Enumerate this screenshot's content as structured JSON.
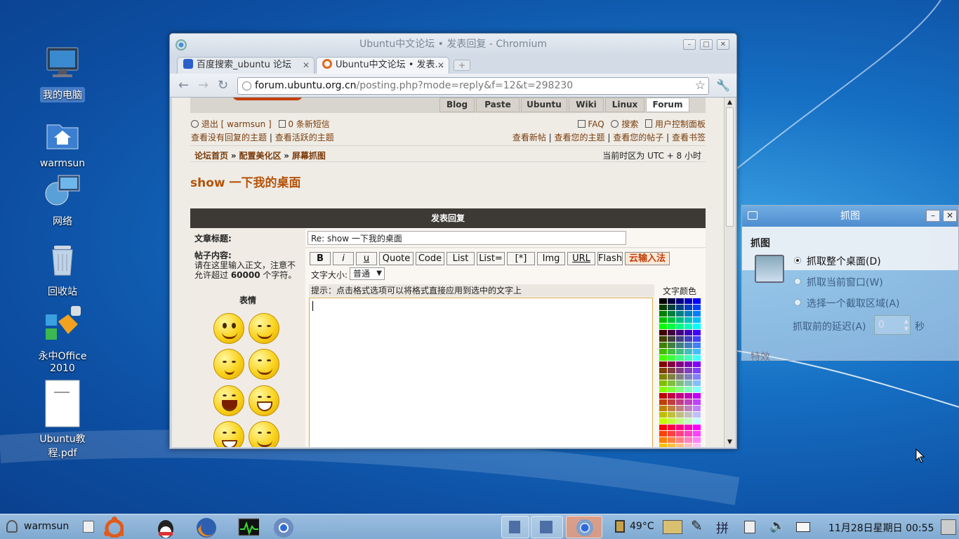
{
  "desktop": {
    "icons": [
      {
        "label": "我的电脑"
      },
      {
        "label": "warmsun"
      },
      {
        "label": "网络"
      },
      {
        "label": "回收站"
      },
      {
        "label": "永中Office 2010"
      },
      {
        "label": "Ubuntu教程.pdf"
      }
    ]
  },
  "browser": {
    "title": "Ubuntu中文论坛 • 发表回复 - Chromium",
    "tabs": [
      {
        "label": "百度搜索_ubuntu 论坛"
      },
      {
        "label": "Ubuntu中文论坛 • 发表..."
      }
    ],
    "url_host": "forum.ubuntu.org.cn",
    "url_path": "/posting.php?mode=reply&f=12&t=298230"
  },
  "forum": {
    "nav_tabs": [
      "Blog",
      "Paste",
      "Ubuntu",
      "Wiki",
      "Linux",
      "Forum"
    ],
    "logout": "退出 [ warmsun ]",
    "new_msgs": "0 条新短信",
    "faq": "FAQ",
    "search": "搜索",
    "ucp": "用户控制面板",
    "link_unanswered": "查看没有回复的主题",
    "link_active": "查看活跃的主题",
    "link_new": "查看新帖",
    "link_yourtopics": "查看您的主题",
    "link_yourposts": "查看您的帖子",
    "link_bookmarks": "查看书签",
    "sep": "|",
    "bc_home": "论坛首页",
    "bc_arrow": "»",
    "bc_cat": "配置美化区",
    "bc_sub": "屏幕抓图",
    "timezone": "当前时区为 UTC + 8 小时",
    "topic_title": "show 一下我的桌面",
    "form_header": "发表回复",
    "subject_label": "文章标题:",
    "subject_value": "Re: show 一下我的桌面",
    "content_label": "帖子内容:",
    "content_hint_a": "请在这里输入正文，注意不允许超过 ",
    "content_hint_num": "60000",
    "content_hint_b": " 个字符。",
    "smilies_label": "表情",
    "format_buttons": [
      "B",
      "i",
      "u",
      "Quote",
      "Code",
      "List",
      "List=",
      "[*]",
      "Img",
      "URL",
      "Flash",
      "云输入法"
    ],
    "font_size_label": "文字大小:",
    "font_size_value": "普通",
    "tip": "提示：点击格式选项可以将格式直接应用到选中的文字上",
    "text_color_label": "文字颜色"
  },
  "screenshot_dialog": {
    "title": "抓图",
    "section": "抓图",
    "opt_desktop": "抓取整个桌面(D)",
    "opt_window": "抓取当前窗口(W)",
    "opt_area": "选择一个截取区域(A)",
    "delay_label": "抓取前的延迟(A)",
    "delay_value": "0",
    "delay_unit": "秒",
    "effects": "特效"
  },
  "taskbar": {
    "user": "warmsun",
    "temp": "49°C",
    "clock": "11月28日星期日 00:55"
  },
  "colors": {
    "forum_header_bg": "#3d3a35",
    "link": "#7a3b0b",
    "title_orange": "#b5520a"
  }
}
